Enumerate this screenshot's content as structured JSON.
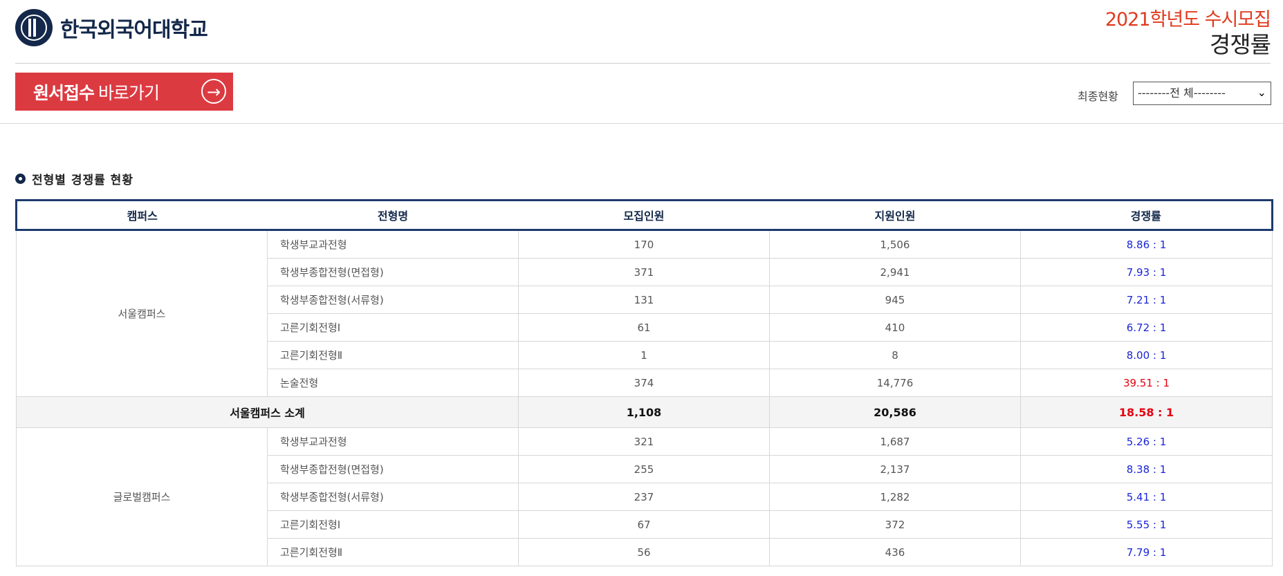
{
  "header": {
    "logo_name": "한국외국어대학교",
    "title_year": "2021학년도 수시모집",
    "title_main": "경쟁률"
  },
  "apply_button": {
    "strong_text": "원서접수",
    "light_text": "바로가기",
    "icon": "arrow-right-circle-icon"
  },
  "filter": {
    "label": "최종현황",
    "selected": "--------전 체--------"
  },
  "section": {
    "title": "전형별 경쟁률 현황"
  },
  "table": {
    "columns": [
      "캠퍼스",
      "전형명",
      "모집인원",
      "지원인원",
      "경쟁률"
    ],
    "groups": [
      {
        "campus": "서울캠퍼스",
        "rows": [
          {
            "type": "학생부교과전형",
            "quota": "170",
            "applicants": "1,506",
            "ratio": "8.86 : 1"
          },
          {
            "type": "학생부종합전형(면접형)",
            "quota": "371",
            "applicants": "2,941",
            "ratio": "7.93 : 1"
          },
          {
            "type": "학생부종합전형(서류형)",
            "quota": "131",
            "applicants": "945",
            "ratio": "7.21 : 1"
          },
          {
            "type": "고른기회전형Ⅰ",
            "quota": "61",
            "applicants": "410",
            "ratio": "6.72 : 1"
          },
          {
            "type": "고른기회전형Ⅱ",
            "quota": "1",
            "applicants": "8",
            "ratio": "8.00 : 1"
          },
          {
            "type": "논술전형",
            "quota": "374",
            "applicants": "14,776",
            "ratio": "39.51 : 1"
          }
        ],
        "subtotal": {
          "label": "서울캠퍼스 소계",
          "quota": "1,108",
          "applicants": "20,586",
          "ratio": "18.58 : 1"
        }
      },
      {
        "campus": "글로벌캠퍼스",
        "rows": [
          {
            "type": "학생부교과전형",
            "quota": "321",
            "applicants": "1,687",
            "ratio": "5.26 : 1"
          },
          {
            "type": "학생부종합전형(면접형)",
            "quota": "255",
            "applicants": "2,137",
            "ratio": "8.38 : 1"
          },
          {
            "type": "학생부종합전형(서류형)",
            "quota": "237",
            "applicants": "1,282",
            "ratio": "5.41 : 1"
          },
          {
            "type": "고른기회전형Ⅰ",
            "quota": "67",
            "applicants": "372",
            "ratio": "5.55 : 1"
          },
          {
            "type": "고른기회전형Ⅱ",
            "quota": "56",
            "applicants": "436",
            "ratio": "7.79 : 1"
          }
        ]
      }
    ]
  },
  "colors": {
    "navy": "#13284a",
    "apply_red": "#dc3a41",
    "title_red": "#e03a1e",
    "ratio_blue": "#1a24d6",
    "ratio_red": "#e4000f"
  }
}
